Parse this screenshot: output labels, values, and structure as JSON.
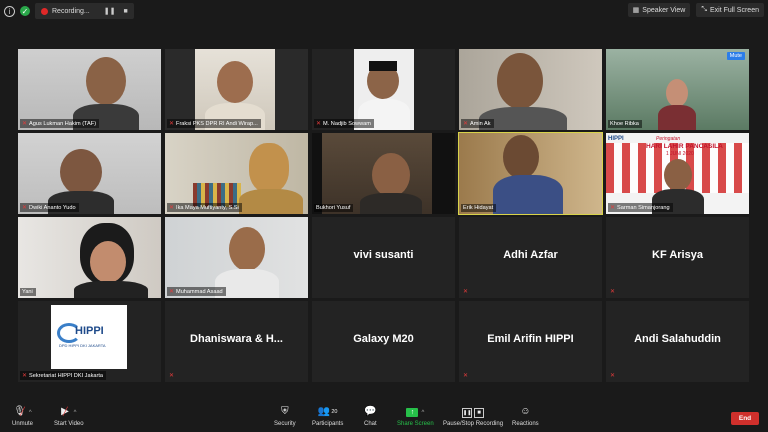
{
  "topbar": {
    "recording_label": "Recording...",
    "speaker_view": "Speaker View",
    "exit_full_screen": "Exit Full Screen"
  },
  "participants": [
    {
      "name": "Agus Lukman Hakim (TAF)"
    },
    {
      "name": "Fraksi PKS DPR RI Andi Wirap..."
    },
    {
      "name": "M. Nadjib Sowwam"
    },
    {
      "name": "Amin Ak"
    },
    {
      "name": "Khoe Ribka"
    },
    {
      "name": "Dwiki Ananto Yudo"
    },
    {
      "name": "Ika Maya Muftiyanty, S.Si"
    },
    {
      "name": "Bukhori Yusuf"
    },
    {
      "name": "Erik Hidayat"
    },
    {
      "name": "Sarman Simanjorang"
    },
    {
      "name": "Yani"
    },
    {
      "name": "Muhammad Asaad"
    },
    {
      "name": "vivi susanti"
    },
    {
      "name": "Adhi Azfar"
    },
    {
      "name": "KF Arisya"
    },
    {
      "name": "Sekretariat HIPPI DKI Jakarta"
    },
    {
      "name": "Dhaniswara & H..."
    },
    {
      "name": "Galaxy M20"
    },
    {
      "name": "Emil Arifin HIPPI"
    },
    {
      "name": "Andi Salahuddin"
    }
  ],
  "tile_labels": {
    "mute": "Mute",
    "hippi_logo": "HIPPI",
    "hippi_sub": "DPD HIPPI DKI JAKARTA",
    "poster_title": "HARI LAHIR PANCASILA",
    "poster_pre": "Peringatan",
    "poster_date": "1 JUNI 2020"
  },
  "toolbar": {
    "unmute": "Unmute",
    "start_video": "Start Video",
    "security": "Security",
    "participants": "Participants",
    "participants_count": "20",
    "chat": "Chat",
    "share_screen": "Share Screen",
    "recording": "Pause/Stop Recording",
    "reactions": "Reactions",
    "end": "End"
  },
  "colors": {
    "active_speaker": "#d8d34a",
    "end_button": "#d0302c",
    "share_screen": "#27c04a",
    "muted_icon": "#e23b3b"
  }
}
